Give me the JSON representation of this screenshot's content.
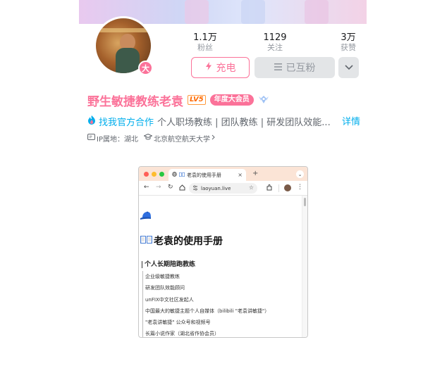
{
  "profile": {
    "avatar_badge": "大",
    "name": "野生敏捷教练老袁",
    "level_badge": "LV5",
    "vip_badge": "年度大会员",
    "stats": [
      {
        "value": "1.1万",
        "label": "粉丝"
      },
      {
        "value": "1129",
        "label": "关注"
      },
      {
        "value": "3万",
        "label": "获赞"
      }
    ],
    "charge_label": "充电",
    "mutual_label": "已互粉",
    "sign_link": "找我官方合作",
    "sign_text": "个人职场教练 | 团队教练 | 研发团队效能...",
    "detail_label": "详情",
    "ip_label": "IP属地：湖北",
    "school": "北京航空航天大学"
  },
  "colors": {
    "accent": "#fb7299",
    "link": "#00aeec",
    "muted": "#9499a0"
  },
  "browser": {
    "tab_title": "老袁的使用手册",
    "url": "laoyuan.live",
    "page_title": "老袁的使用手册",
    "section_title": "个人长期陪跑教练",
    "items": [
      "企业级敏捷教练",
      "研发团队效能顾问",
      "unFIX中文社区发起人",
      "中国最大的敏捷主题个人自媒体（bilibili \"老袁讲敏捷\"）",
      "\"老袁讲敏捷\" 公众号和视频号",
      "长篇小说作家（湖北省作协会员）"
    ]
  }
}
